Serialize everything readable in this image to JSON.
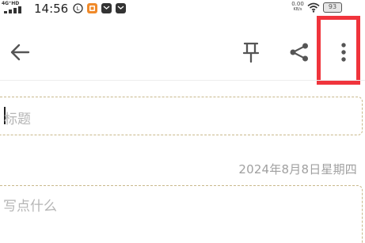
{
  "status_bar": {
    "network_type": "4G⁺HD",
    "time": "14:56",
    "net_speed_value": "0.00",
    "net_speed_unit": "KB/s",
    "battery": "93"
  },
  "toolbar": {
    "back_icon": "arrow-left-icon",
    "pin_icon": "pin-icon",
    "share_icon": "share-icon",
    "more_icon": "more-vertical-icon",
    "highlight_color": "#f0343c"
  },
  "editor": {
    "title_placeholder": "标题",
    "date": "2024年8月8日星期四",
    "body_placeholder": "写点什么"
  }
}
